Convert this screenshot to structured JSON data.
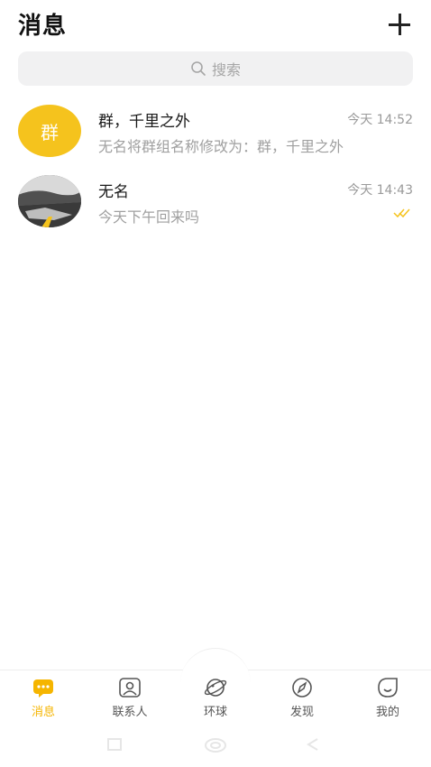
{
  "header": {
    "title": "消息",
    "add_icon": "plus-icon"
  },
  "search": {
    "placeholder": "搜索",
    "icon": "search-icon"
  },
  "conversations": [
    {
      "name": "群，千里之外",
      "time": "今天 14:52",
      "preview": "无名将群组名称修改为：群，千里之外",
      "avatar_text": "群",
      "avatar_color": "#f5c31d"
    },
    {
      "name": "无名",
      "time": "今天 14:43",
      "preview": "今天下午回来吗",
      "avatar_icon": "photo-avatar",
      "status_icon": "double-check-icon",
      "status_color": "#f5c31d"
    }
  ],
  "bottom_nav": {
    "items": [
      {
        "label": "消息",
        "icon": "chat-bubble-icon",
        "active": true
      },
      {
        "label": "联系人",
        "icon": "contact-icon",
        "active": false
      },
      {
        "label": "环球",
        "icon": "planet-icon",
        "active": false
      },
      {
        "label": "发现",
        "icon": "compass-icon",
        "active": false
      },
      {
        "label": "我的",
        "icon": "smile-icon",
        "active": false
      }
    ],
    "active_color": "#f5b500"
  },
  "system_bar": {
    "buttons": [
      "menu-icon",
      "home-icon",
      "back-icon"
    ]
  }
}
